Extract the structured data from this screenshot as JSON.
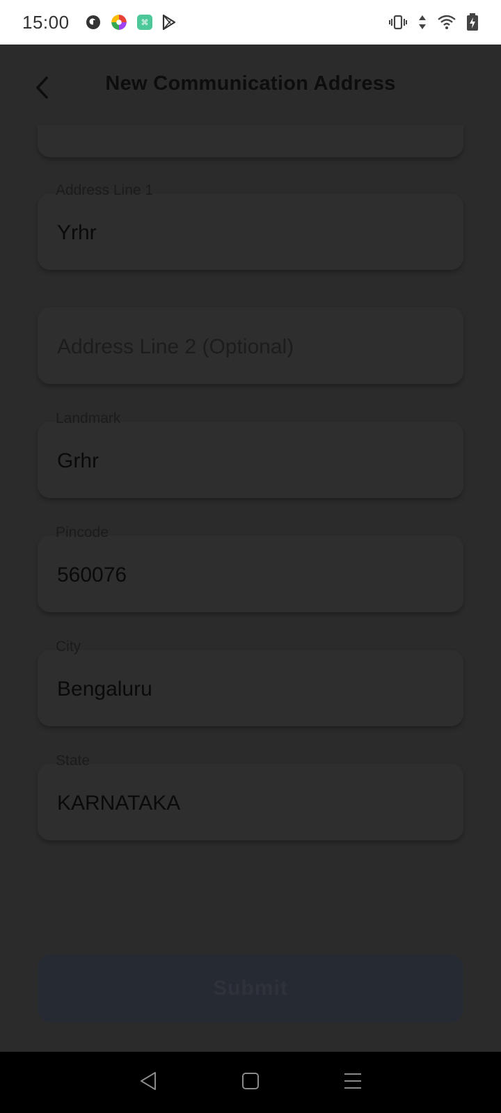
{
  "status_bar": {
    "time": "15:00",
    "app_icons": [
      "app-p-icon",
      "photos-icon",
      "calculator-icon",
      "play-store-icon"
    ],
    "right_icons": [
      "vibrate-icon",
      "data-arrows-icon",
      "wifi-icon",
      "battery-charging-icon"
    ]
  },
  "header": {
    "title": "New Communication Address",
    "back_icon": "back-chevron-icon"
  },
  "form": {
    "address_line_1": {
      "label": "Address Line 1",
      "value": "Yrhr"
    },
    "address_line_2": {
      "placeholder": "Address Line 2 (Optional)"
    },
    "landmark": {
      "label": "Landmark",
      "value": "Grhr"
    },
    "pincode": {
      "label": "Pincode",
      "value": "560076"
    },
    "city": {
      "label": "City",
      "value": "Bengaluru"
    },
    "state": {
      "label": "State",
      "value": "KARNATAKA"
    }
  },
  "submit": {
    "label": "Submit"
  },
  "nav_bar": {
    "icons": [
      "nav-back-icon",
      "nav-home-icon",
      "nav-menu-icon"
    ]
  },
  "colors": {
    "overlay_background": "#2b2b2b",
    "card_background": "#2e2e2e",
    "submit_background": "#262a33",
    "status_bar_background": "#ffffff",
    "nav_bar_background": "#000000"
  }
}
